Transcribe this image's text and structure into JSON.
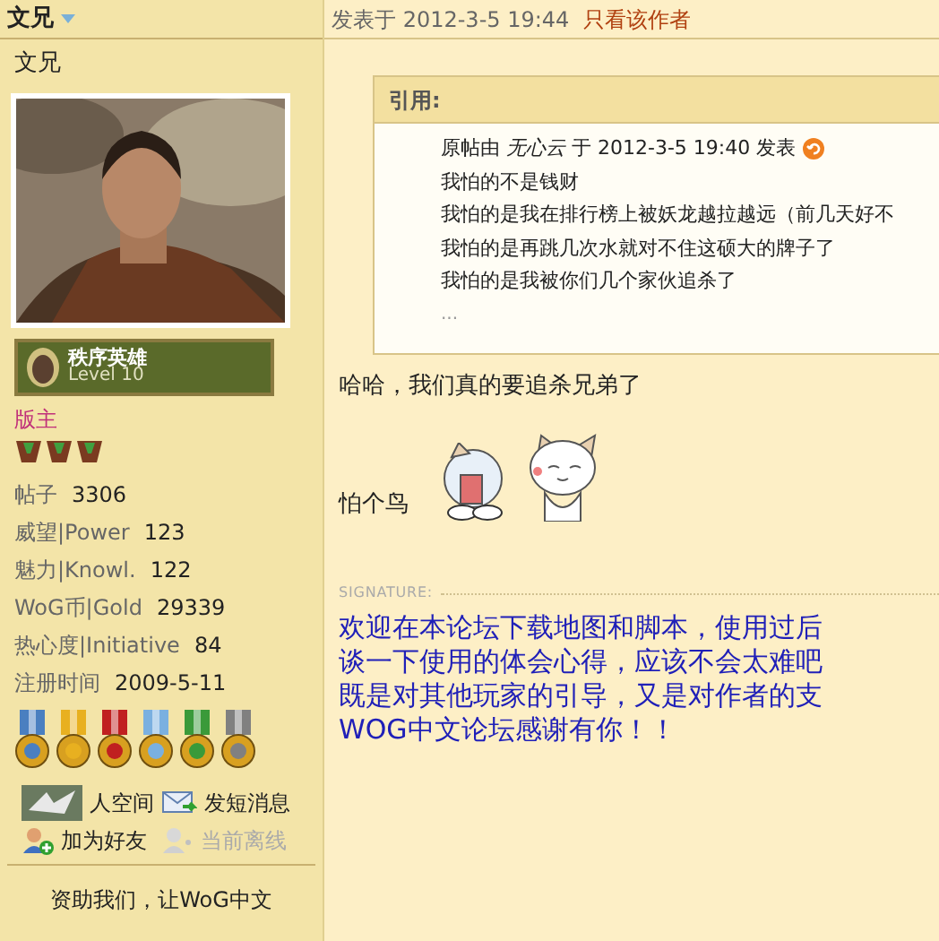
{
  "author": {
    "name": "文兄",
    "nickname": "文兄",
    "rank_badge": {
      "title": "秩序英雄",
      "level": "Level 10"
    },
    "role": "版主",
    "stats": [
      {
        "label": "帖子",
        "value": "3306"
      },
      {
        "label": "威望|Power",
        "value": "123"
      },
      {
        "label": "魅力|Knowl.",
        "value": "122"
      },
      {
        "label": "WoG币|Gold",
        "value": "29339"
      },
      {
        "label": "热心度|Initiative",
        "value": "84"
      },
      {
        "label": "注册时间",
        "value": "2009-5-11"
      }
    ],
    "medals": [
      {
        "color": "#4a7fc0"
      },
      {
        "color": "#e8b020"
      },
      {
        "color": "#c02020"
      },
      {
        "color": "#7ab0e0"
      },
      {
        "color": "#3a9a3a"
      },
      {
        "color": "#808080"
      }
    ],
    "actions": [
      {
        "label": "人空间",
        "disabled": false
      },
      {
        "label": "发短消息",
        "disabled": false
      },
      {
        "label": "加为好友",
        "disabled": false
      },
      {
        "label": "当前离线",
        "disabled": true
      }
    ],
    "donate": "资助我们，让WoG中文"
  },
  "post": {
    "posted": "发表于 2012-3-5 19:44",
    "author_only_link": "只看该作者",
    "quote": {
      "title": "引用:",
      "byline_prefix": "原帖由",
      "byline_user": "无心云",
      "byline_suffix": "于 2012-3-5 19:40 发表",
      "lines": [
        "我怕的不是钱财",
        "我怕的是我在排行榜上被妖龙越拉越远（前几天好不",
        "我怕的是再跳几次水就对不住这硕大的牌子了",
        "我怕的是我被你们几个家伙追杀了",
        "..."
      ]
    },
    "body": "哈哈，我们真的要追杀兄弟了",
    "body2": "怕个鸟",
    "signature_label": "SIGNATURE:",
    "signature": [
      "欢迎在本论坛下载地图和脚本，使用过后",
      "谈一下使用的体会心得，应该不会太难吧",
      "既是对其他玩家的引导，又是对作者的支",
      "WOG中文论坛感谢有你！！"
    ]
  }
}
